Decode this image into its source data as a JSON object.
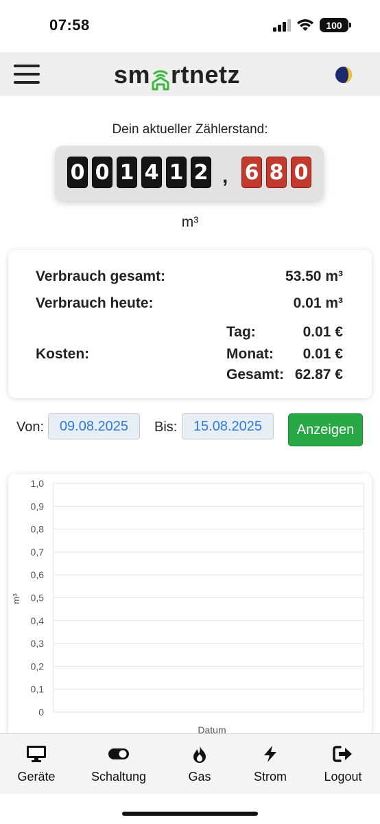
{
  "status_bar": {
    "time": "07:58",
    "battery": "100"
  },
  "header": {
    "logo_text_left": "sm",
    "logo_text_right": "rtnetz"
  },
  "meter": {
    "caption": "Dein aktueller Zählerstand:",
    "integer_digits": [
      "0",
      "0",
      "1",
      "4",
      "1",
      "2"
    ],
    "separator": ",",
    "decimal_digits": [
      "6",
      "8",
      "0"
    ],
    "unit": "m³"
  },
  "summary": {
    "total_label": "Verbrauch gesamt:",
    "total_value": "53.50 m³",
    "today_label": "Verbrauch heute:",
    "today_value": "0.01 m³",
    "costs_label": "Kosten:",
    "day_label": "Tag:",
    "day_value": "0.01 €",
    "month_label": "Monat:",
    "month_value": "0.01 €",
    "overall_label": "Gesamt:",
    "overall_value": "62.87 €"
  },
  "filter": {
    "from_label": "Von:",
    "from_value": "09.08.2025",
    "to_label": "Bis:",
    "to_value": "15.08.2025",
    "show_label": "Anzeigen"
  },
  "chart_data": {
    "type": "bar",
    "ylabel": "m³",
    "xlabel": "Datum",
    "ylim": [
      0,
      1.0
    ],
    "yticks": [
      "0",
      "0,1",
      "0,2",
      "0,3",
      "0,4",
      "0,5",
      "0,6",
      "0,7",
      "0,8",
      "0,9",
      "1,0"
    ],
    "categories": [],
    "values": [],
    "grid": true
  },
  "nav": [
    {
      "label": "Geräte",
      "icon": "monitor-icon"
    },
    {
      "label": "Schaltung",
      "icon": "toggle-icon"
    },
    {
      "label": "Gas",
      "icon": "flame-icon"
    },
    {
      "label": "Strom",
      "icon": "bolt-icon"
    },
    {
      "label": "Logout",
      "icon": "logout-icon"
    }
  ],
  "colors": {
    "accent_green": "#28a745",
    "date_text": "#2f7ad8",
    "meter_red": "#c23a2e",
    "logo_green": "#3db83d"
  }
}
